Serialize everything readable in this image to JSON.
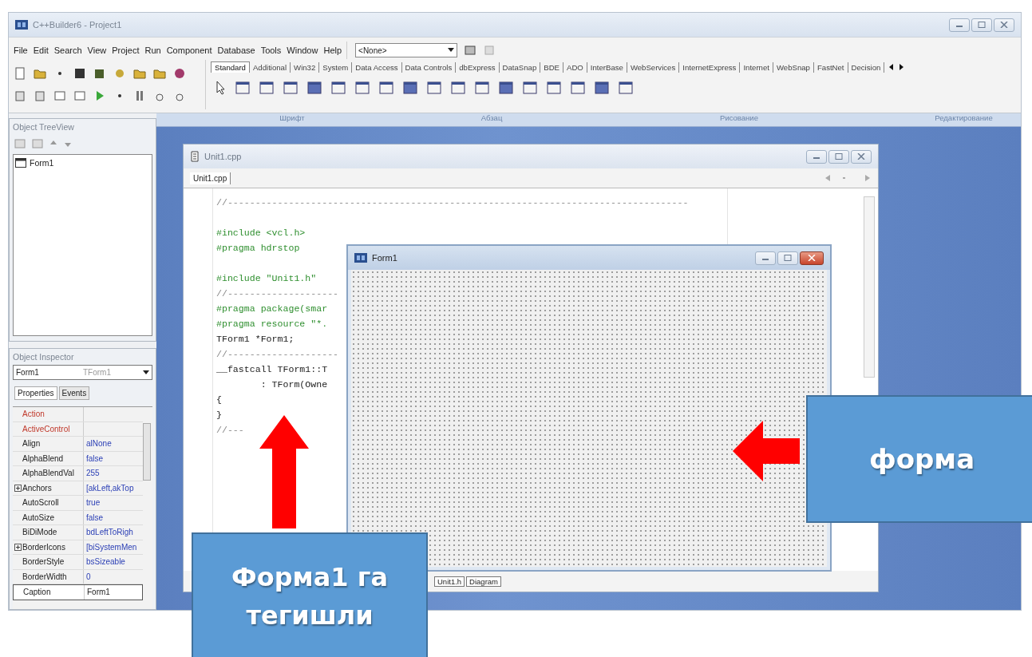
{
  "window": {
    "title": "C++Builder6 - Project1"
  },
  "menu": [
    "File",
    "Edit",
    "Search",
    "View",
    "Project",
    "Run",
    "Component",
    "Database",
    "Tools",
    "Window",
    "Help"
  ],
  "component_selector": {
    "value": "<None>"
  },
  "palette_tabs": [
    {
      "label": "Standard",
      "selected": true
    },
    {
      "label": "Additional",
      "selected": false
    },
    {
      "label": "Win32",
      "selected": false
    },
    {
      "label": "System",
      "selected": false
    },
    {
      "label": "Data Access",
      "selected": false
    },
    {
      "label": "Data Controls",
      "selected": false
    },
    {
      "label": "dbExpress",
      "selected": false
    },
    {
      "label": "DataSnap",
      "selected": false
    },
    {
      "label": "BDE",
      "selected": false
    },
    {
      "label": "ADO",
      "selected": false
    },
    {
      "label": "InterBase",
      "selected": false
    },
    {
      "label": "WebServices",
      "selected": false
    },
    {
      "label": "InternetExpress",
      "selected": false
    },
    {
      "label": "Internet",
      "selected": false
    },
    {
      "label": "WebSnap",
      "selected": false
    },
    {
      "label": "FastNet",
      "selected": false
    },
    {
      "label": "Decision",
      "selected": false
    }
  ],
  "background_ribbon": {
    "groups": [
      "Шрифт",
      "Абзац",
      "Рисование",
      "Редактирование"
    ]
  },
  "object_treeview": {
    "title": "Object TreeView",
    "items": [
      {
        "label": "Form1"
      }
    ]
  },
  "object_inspector": {
    "title": "Object Inspector",
    "object": "Form1",
    "class": "TForm1",
    "tabs": [
      {
        "label": "Properties",
        "selected": true
      },
      {
        "label": "Events",
        "selected": false
      }
    ],
    "properties": [
      {
        "name": "Action",
        "kind": "reference",
        "expandable": false,
        "selected": false
      },
      {
        "name": "ActiveControl",
        "kind": "reference",
        "expandable": false,
        "selected": false
      },
      {
        "name": "Align",
        "value": "alNone",
        "kind": "plain",
        "expandable": false,
        "selected": false
      },
      {
        "name": "AlphaBlend",
        "value": "false",
        "kind": "plain",
        "expandable": false,
        "selected": false
      },
      {
        "name": "AlphaBlendVal",
        "value": "255",
        "kind": "plain",
        "expandable": false,
        "selected": false
      },
      {
        "name": "Anchors",
        "value": "[akLeft,akTop",
        "kind": "plain",
        "expandable": true,
        "selected": false
      },
      {
        "name": "AutoScroll",
        "value": "true",
        "kind": "plain",
        "expandable": false,
        "selected": false
      },
      {
        "name": "AutoSize",
        "value": "false",
        "kind": "plain",
        "expandable": false,
        "selected": false
      },
      {
        "name": "BiDiMode",
        "value": "bdLeftToRigh",
        "kind": "plain",
        "expandable": false,
        "selected": false
      },
      {
        "name": "BorderIcons",
        "value": "[biSystemMen",
        "kind": "plain",
        "expandable": true,
        "selected": false
      },
      {
        "name": "BorderStyle",
        "value": "bsSizeable",
        "kind": "plain",
        "expandable": false,
        "selected": false
      },
      {
        "name": "BorderWidth",
        "value": "0",
        "kind": "plain",
        "expandable": false,
        "selected": false
      },
      {
        "name": "Caption",
        "value": "Form1",
        "kind": "plain",
        "expandable": false,
        "selected": true
      }
    ]
  },
  "editor": {
    "title": "Unit1.cpp",
    "tabs": [
      {
        "label": "Unit1.cpp",
        "selected": true
      }
    ],
    "lines": [
      {
        "text": "//-----------------------------------------------------------------------------------",
        "kind": "comment"
      },
      {
        "kind": "blank"
      },
      {
        "text": "#include <vcl.h>",
        "kind": "directive"
      },
      {
        "text": "#pragma hdrstop",
        "kind": "directive"
      },
      {
        "kind": "blank"
      },
      {
        "text": "#include \"Unit1.h\"",
        "kind": "directive"
      },
      {
        "text": "//--------------------",
        "kind": "comment"
      },
      {
        "text": "#pragma package(smar",
        "kind": "directive"
      },
      {
        "text": "#pragma resource \"*.",
        "kind": "directive"
      },
      {
        "text": "TForm1 *Form1;",
        "kind": "code"
      },
      {
        "text": "//--------------------",
        "kind": "comment"
      },
      {
        "text": "__fastcall TForm1::T",
        "kind": "code"
      },
      {
        "text": "        : TForm(Owne",
        "kind": "code"
      },
      {
        "text": "{",
        "kind": "code"
      },
      {
        "text": "}",
        "kind": "code"
      },
      {
        "text": "//---",
        "kind": "comment"
      }
    ],
    "bottom_tabs": [
      "Unit1.h",
      "Diagram"
    ]
  },
  "form_window": {
    "title": "Form1"
  },
  "callouts": [
    {
      "text": "Форма1 га тегишли",
      "kind": "up"
    },
    {
      "text": "форма",
      "kind": "left"
    }
  ]
}
